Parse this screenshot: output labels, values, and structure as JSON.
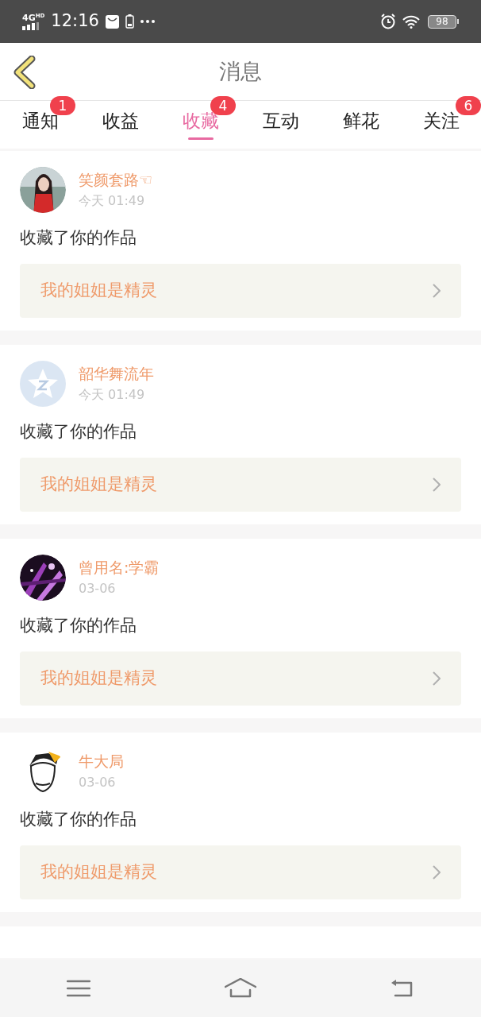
{
  "status_bar": {
    "network": "4G",
    "network_badge": "HD",
    "time": "12:16",
    "battery": "98"
  },
  "header": {
    "title": "消息"
  },
  "tabs": [
    {
      "label": "通知",
      "selected": false,
      "badge": "1"
    },
    {
      "label": "收益",
      "selected": false
    },
    {
      "label": "收藏",
      "selected": true,
      "badge": "4"
    },
    {
      "label": "互动",
      "selected": false
    },
    {
      "label": "鲜花",
      "selected": false
    },
    {
      "label": "关注",
      "selected": false,
      "badge": "6"
    }
  ],
  "messages": [
    {
      "user": "笑颜套路☜",
      "time": "今天 01:49",
      "action": "收藏了你的作品",
      "work": "我的姐姐是精灵"
    },
    {
      "avatar": {
        "kind": "default"
      },
      "user": "韶华舞流年",
      "time": "今天 01:49",
      "action": "收藏了你的作品",
      "work": "我的姐姐是精灵"
    },
    {
      "user": "曾用名:学霸",
      "time": "03-06",
      "action": "收藏了你的作品",
      "work": "我的姐姐是精灵"
    },
    {
      "user": "牛大局",
      "time": "03-06",
      "action": "收藏了你的作品",
      "work": "我的姐姐是精灵"
    }
  ]
}
